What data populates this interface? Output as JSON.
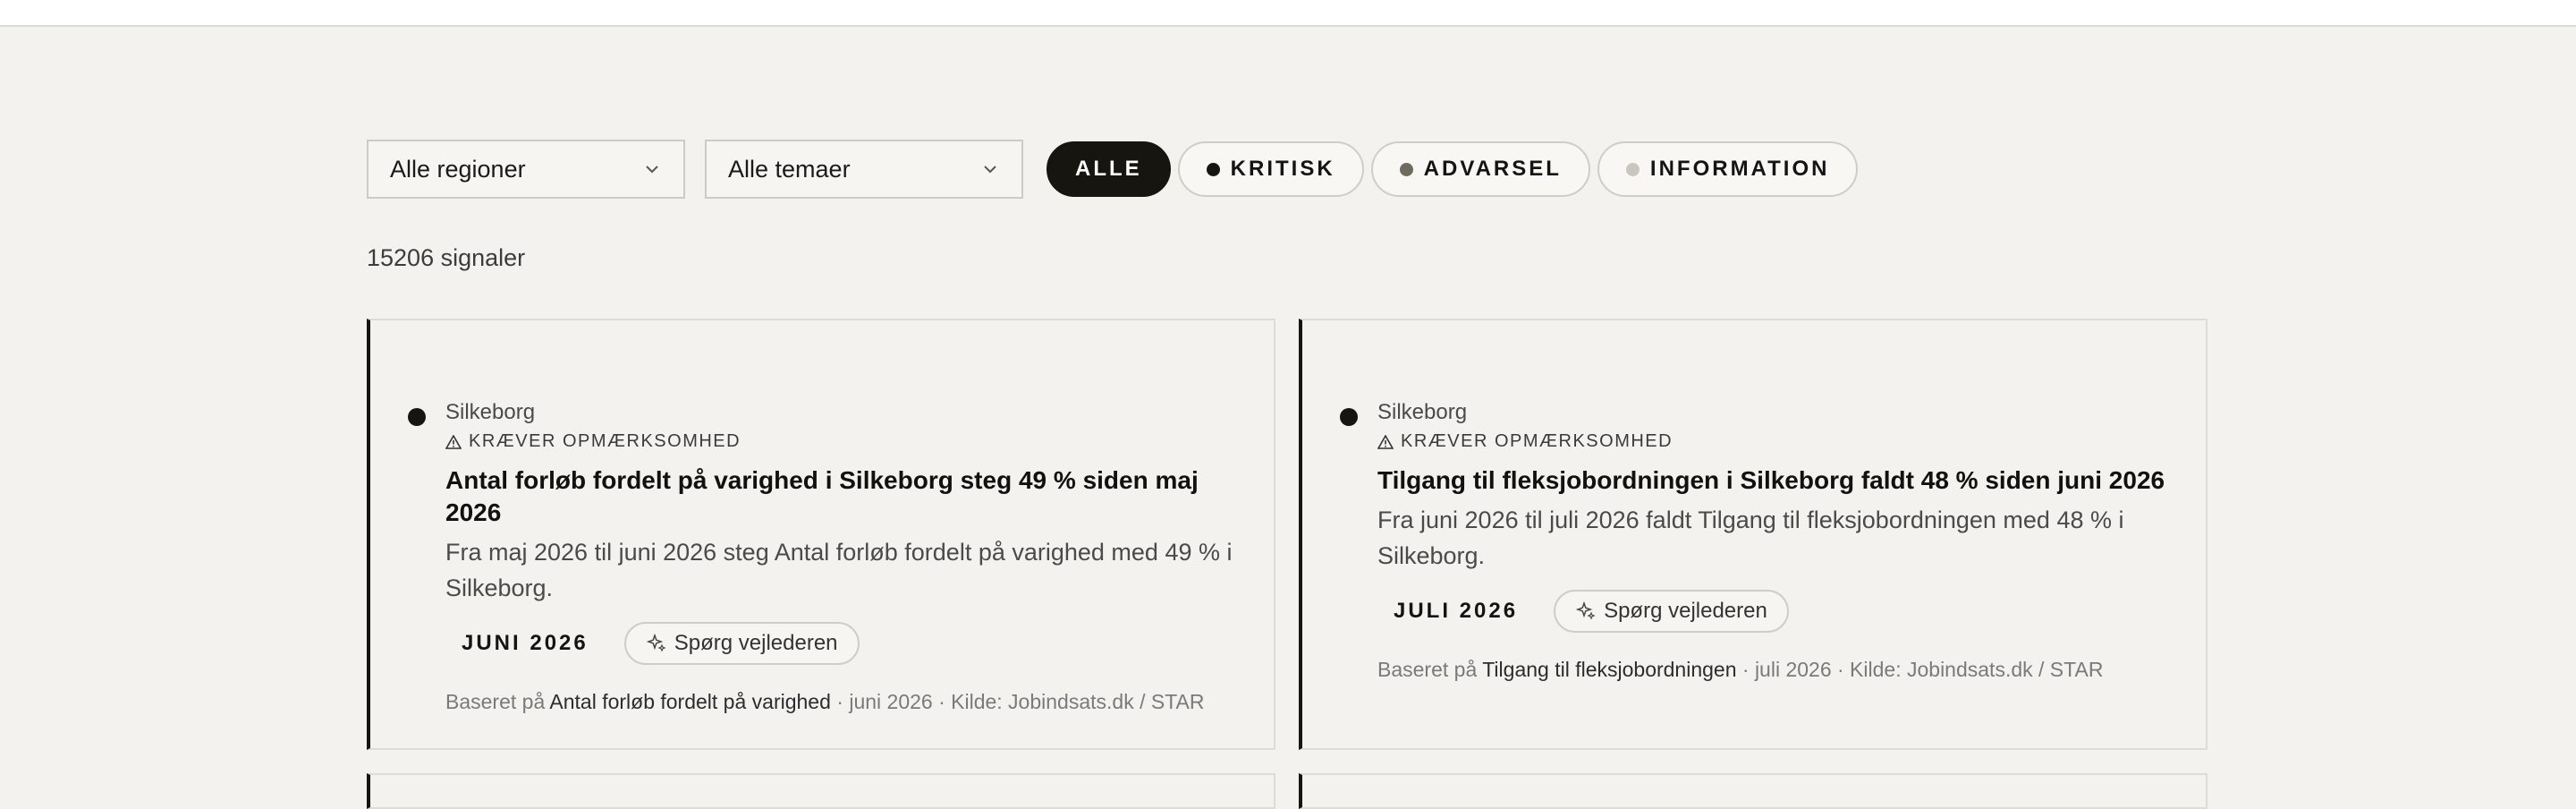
{
  "filters": {
    "region": "Alle regioner",
    "theme": "Alle temaer",
    "pills": [
      {
        "label": "ALLE",
        "color": ""
      },
      {
        "label": "KRITISK",
        "color": "#161510"
      },
      {
        "label": "ADVARSEL",
        "color": "#6f6a5e"
      },
      {
        "label": "INFORMATION",
        "color": "#c9c6bf"
      }
    ]
  },
  "count": "15206 signaler",
  "cards": [
    {
      "region": "Silkeborg",
      "severity": "KRÆVER OPMÆRKSOMHED",
      "title": "Antal forløb fordelt på varighed i Silkeborg steg 49 % siden maj 2026",
      "desc": "Fra maj 2026 til juni 2026 steg Antal forløb fordelt på varighed med 49 % i Silkeborg.",
      "date": "JUNI 2026",
      "ask": "Spørg vejlederen",
      "source_prefix": "Baseret på",
      "source_metric": "Antal forløb fordelt på varighed",
      "source_suffix": "· juni 2026 · Kilde: Jobindsats.dk / STAR"
    },
    {
      "region": "Silkeborg",
      "severity": "KRÆVER OPMÆRKSOMHED",
      "title": "Tilgang til fleksjobordningen i Silkeborg faldt 48 % siden juni 2026",
      "desc": "Fra juni 2026 til juli 2026 faldt Tilgang til fleksjobordningen med 48 % i Silkeborg.",
      "date": "JULI 2026",
      "ask": "Spørg vejlederen",
      "source_prefix": "Baseret på",
      "source_metric": "Tilgang til fleksjobordningen",
      "source_suffix": "· juli 2026 · Kilde: Jobindsats.dk / STAR"
    }
  ]
}
